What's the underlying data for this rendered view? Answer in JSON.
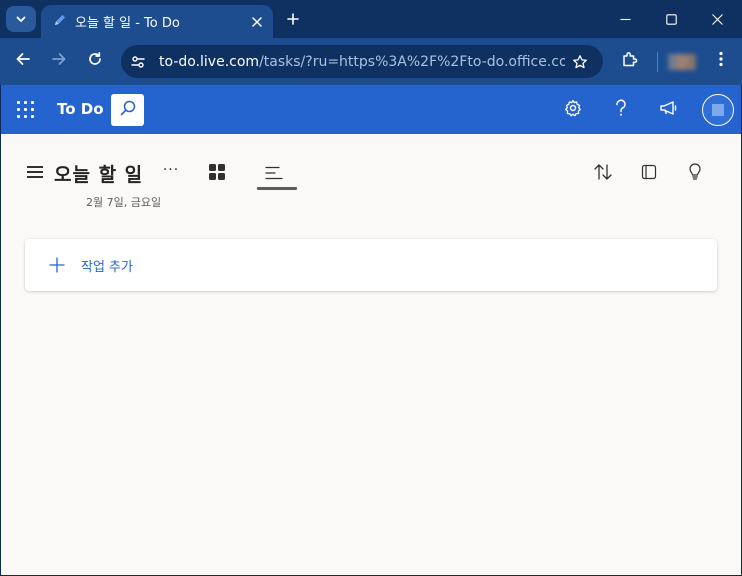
{
  "browser": {
    "tab": {
      "title": "오늘 할 일 - To Do"
    },
    "url": {
      "host": "to-do.live.com",
      "path": "/tasks/?ru=https%3A%2F%2Fto-do.office.com..."
    }
  },
  "app": {
    "name": "To Do",
    "accent": "#2564cf"
  },
  "list": {
    "title": "오늘 할 일",
    "date": "2월 7일, 금요일",
    "more": "···"
  },
  "add_task": {
    "label": "작업 추가"
  },
  "icons": {
    "tab_search": "chevron-down-icon",
    "tab_favicon": "pencil-icon",
    "tab_close": "close-icon",
    "new_tab": "plus-icon",
    "back": "arrow-left-icon",
    "forward": "arrow-right-icon",
    "reload": "reload-icon",
    "site_info": "tune-icon",
    "bookmark": "star-icon",
    "extensions": "puzzle-icon",
    "menu": "kebab-icon",
    "waffle": "app-launcher-icon",
    "search": "search-icon",
    "settings": "gear-icon",
    "help": "question-icon",
    "feedback": "megaphone-icon",
    "sort": "sort-icon",
    "details": "panel-icon",
    "suggestions": "lightbulb-icon"
  }
}
